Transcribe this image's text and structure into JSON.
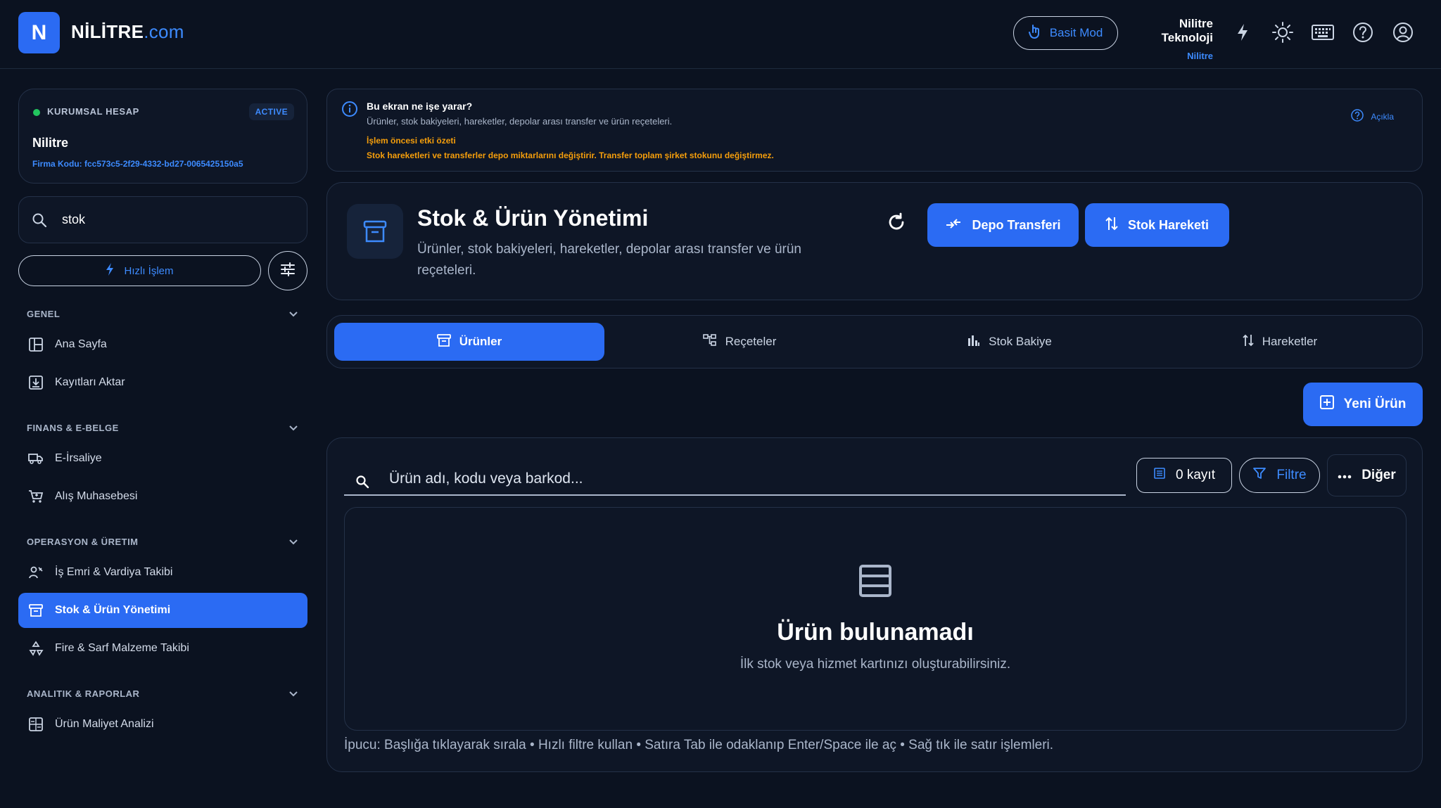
{
  "topbar": {
    "logo_letter": "N",
    "brand_main": "NİLİTRE",
    "brand_suffix": ".com",
    "mode_label": "Basit Mod",
    "company_name": "Nilitre Teknoloji",
    "company_sub": "Nilitre"
  },
  "account": {
    "label": "KURUMSAL HESAP",
    "badge": "ACTIVE",
    "name": "Nilitre",
    "code": "Firma Kodu: fcc573c5-2f29-4332-bd27-0065425150a5"
  },
  "sidebar": {
    "search_value": "stok",
    "quick_label": "Hızlı İşlem",
    "sections": [
      {
        "title": "GENEL",
        "items": [
          "Ana Sayfa",
          "Kayıtları Aktar"
        ]
      },
      {
        "title": "FINANS & E-BELGE",
        "items": [
          "E-İrsaliye",
          "Alış Muhasebesi"
        ]
      },
      {
        "title": "OPERASYON & ÜRETIM",
        "items": [
          "İş Emri & Vardiya Takibi",
          "Stok & Ürün Yönetimi",
          "Fire & Sarf Malzeme Takibi"
        ]
      },
      {
        "title": "ANALITIK & RAPORLAR",
        "items": [
          "Ürün Maliyet Analizi"
        ]
      }
    ],
    "active_item": "Stok & Ürün Yönetimi"
  },
  "info": {
    "title": "Bu ekran ne işe yarar?",
    "desc": "Ürünler, stok bakiyeleri, hareketler, depolar arası transfer ve ürün reçeteleri.",
    "warn_title": "İşlem öncesi etki özeti",
    "warn_text": "Stok hareketleri ve transferler depo miktarlarını değiştirir. Transfer toplam şirket stokunu değiştirmez.",
    "help_label": "Açıkla"
  },
  "header": {
    "title": "Stok & Ürün Yönetimi",
    "desc": "Ürünler, stok bakiyeleri, hareketler, depolar arası transfer ve ürün reçeteleri.",
    "transfer_label": "Depo Transferi",
    "movement_label": "Stok Hareketi"
  },
  "tabs": [
    "Ürünler",
    "Reçeteler",
    "Stok Bakiye",
    "Hareketler"
  ],
  "new_product_label": "Yeni Ürün",
  "table": {
    "search_placeholder": "Ürün adı, kodu veya barkod...",
    "count_label": "0 kayıt",
    "filter_label": "Filtre",
    "more_label": "Diğer",
    "empty_title": "Ürün bulunamadı",
    "empty_sub": "İlk stok veya hizmet kartınızı oluşturabilirsiniz.",
    "tip": "İpucu: Başlığa tıklayarak sırala • Hızlı filtre kullan • Satıra Tab ile odaklanıp Enter/Space ile aç • Sağ tık ile satır işlemleri."
  },
  "colors": {
    "accent": "#2b6bf3",
    "link": "#3d8bff",
    "warning": "#f59e0b",
    "success": "#22c55e",
    "background": "#0b1220"
  }
}
